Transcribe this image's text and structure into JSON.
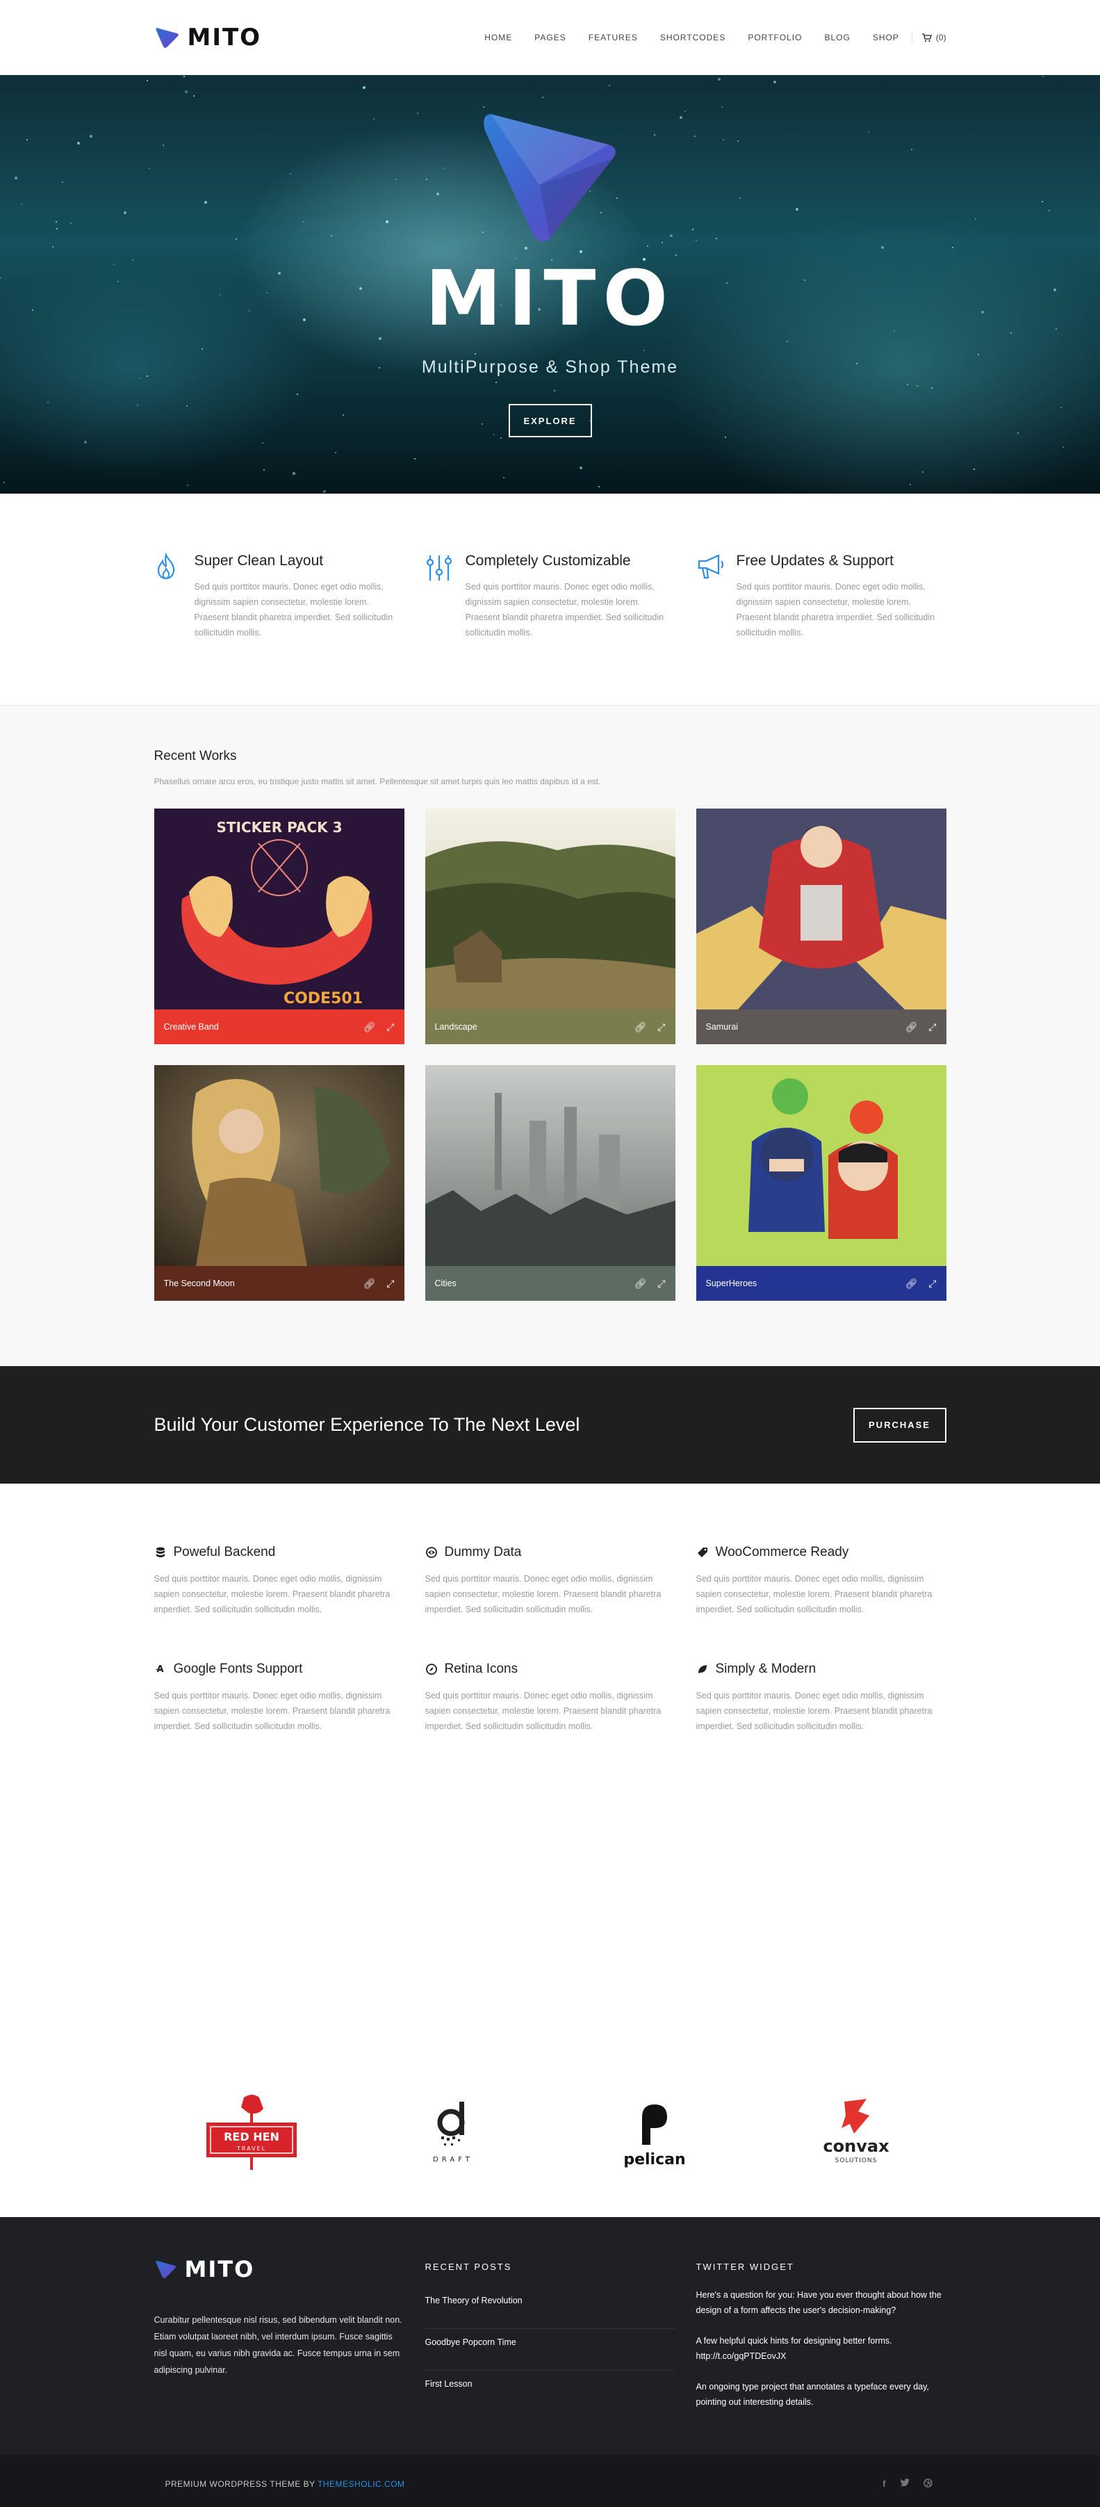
{
  "header": {
    "logo_text": "MITO",
    "nav": [
      "HOME",
      "PAGES",
      "FEATURES",
      "SHORTCODES",
      "PORTFOLIO",
      "BLOG",
      "SHOP"
    ],
    "cart_count": "(0)"
  },
  "hero": {
    "title": "MITO",
    "subtitle": "MultiPurpose & Shop Theme",
    "button": "EXPLORE"
  },
  "features_top": [
    {
      "icon": "flame-icon",
      "title": "Super Clean Layout",
      "text": "Sed quis porttitor mauris. Donec eget odio mollis, dignissim sapien consectetur, molestie lorem. Praesent blandit pharetra imperdiet. Sed sollicitudin sollicitudin mollis."
    },
    {
      "icon": "sliders-icon",
      "title": "Completely Customizable",
      "text": "Sed quis porttitor mauris. Donec eget odio mollis, dignissim sapien consectetur, molestie lorem. Praesent blandit pharetra imperdiet. Sed sollicitudin sollicitudin mollis."
    },
    {
      "icon": "megaphone-icon",
      "title": "Free Updates & Support",
      "text": "Sed quis porttitor mauris. Donec eget odio mollis, dignissim sapien consectetur, molestie lorem. Praesent blandit pharetra imperdiet. Sed sollicitudin sollicitudin mollis."
    }
  ],
  "works": {
    "title": "Recent Works",
    "desc": "Phasellus ornare arcu eros, eu tristique justo mattis sit amet. Pellentesque sit amet turpis quis leo mattis dapibus id a est.",
    "items": [
      {
        "label": "Creative Band",
        "bar_color": "#e8382d"
      },
      {
        "label": "Landscape",
        "bar_color": "#7b7d4e"
      },
      {
        "label": "Samurai",
        "bar_color": "#5e5856"
      },
      {
        "label": "The Second Moon",
        "bar_color": "#5e2a1c"
      },
      {
        "label": "Cities",
        "bar_color": "#5d6b63"
      },
      {
        "label": "SuperHeroes",
        "bar_color": "#233493"
      }
    ]
  },
  "cta": {
    "text": "Build Your Customer Experience To The Next Level",
    "button": "PURCHASE"
  },
  "features_bottom": [
    {
      "icon": "database-icon",
      "title": "Poweful Backend",
      "text": "Sed quis porttitor mauris. Donec eget odio mollis, dignissim sapien consectetur, molestie lorem. Praesent blandit pharetra imperdiet. Sed sollicitudin sollicitudin mollis."
    },
    {
      "icon": "eye-icon",
      "title": "Dummy Data",
      "text": "Sed quis porttitor mauris. Donec eget odio mollis, dignissim sapien consectetur, molestie lorem. Praesent blandit pharetra imperdiet. Sed sollicitudin sollicitudin mollis."
    },
    {
      "icon": "tag-icon",
      "title": "WooCommerce Ready",
      "text": "Sed quis porttitor mauris. Donec eget odio mollis, dignissim sapien consectetur, molestie lorem. Praesent blandit pharetra imperdiet. Sed sollicitudin sollicitudin mollis."
    },
    {
      "icon": "font-icon",
      "title": "Google Fonts Support",
      "text": "Sed quis porttitor mauris. Donec eget odio mollis, dignissim sapien consectetur, molestie lorem. Praesent blandit pharetra imperdiet. Sed sollicitudin sollicitudin mollis."
    },
    {
      "icon": "compass-icon",
      "title": "Retina Icons",
      "text": "Sed quis porttitor mauris. Donec eget odio mollis, dignissim sapien consectetur, molestie lorem. Praesent blandit pharetra imperdiet. Sed sollicitudin sollicitudin mollis."
    },
    {
      "icon": "leaf-icon",
      "title": "Simply & Modern",
      "text": "Sed quis porttitor mauris. Donec eget odio mollis, dignissim sapien consectetur, molestie lorem. Praesent blandit pharetra imperdiet. Sed sollicitudin sollicitudin mollis."
    }
  ],
  "clients": {
    "redhen": {
      "line1": "RED HEN",
      "line2": "TRAVEL"
    },
    "draft": "DRAFT",
    "pelican": "pelican",
    "convax": {
      "line1": "convax",
      "line2": "SOLUTIONS"
    }
  },
  "footer": {
    "logo_text": "MITO",
    "about": "Curabitur pellentesque nisl risus, sed bibendum velit blandit non. Etiam volutpat laoreet nibh, vel interdum ipsum. Fusce sagittis nisl quam, eu varius nibh gravida ac. Fusce tempus urna in sem adipiscing pulvinar.",
    "recent_posts_title": "RECENT POSTS",
    "posts": [
      "The Theory of Revolution",
      "Goodbye Popcorn Time",
      "First Lesson"
    ],
    "twitter_title": "TWITTER WIDGET",
    "tweets": [
      "Here's a question for you: Have you ever thought about how the design of a form affects the user's decision-making?",
      "A few helpful quick hints for designing better forms. http://t.co/gqPTDEovJX",
      "An ongoing type project that annotates a typeface every day, pointing out interesting details."
    ]
  },
  "bottombar": {
    "copy": "PREMIUM WORDPRESS THEME BY ",
    "link": "THEMESHOLIC.COM",
    "socials": [
      "facebook-icon",
      "twitter-icon",
      "dribbble-icon"
    ]
  }
}
